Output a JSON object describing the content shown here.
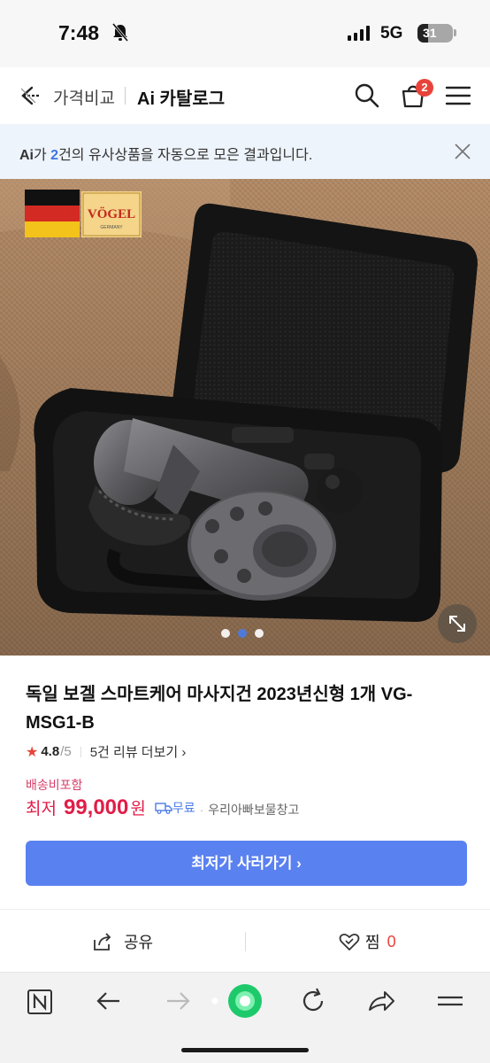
{
  "status_bar": {
    "time": "7:48",
    "network": "5G",
    "battery": "31",
    "battery_level": 0.31
  },
  "header": {
    "compare_label": "가격비교",
    "title": "Ai 카탈로그",
    "cart_count": "2"
  },
  "notice": {
    "prefix": "Ai",
    "mid1": "가 ",
    "count": "2",
    "suffix": "건의 유사상품을 자동으로 모은 결과입니다."
  },
  "product": {
    "brand_text": "VÖGEL",
    "brand_sub": "GERMANY",
    "title": "독일 보겔 스마트케어 마사지건 2023년신형 1개 VG-MSG1-B",
    "rating": "4.8",
    "rating_max": "/5",
    "review_link": "5건 리뷰 더보기",
    "shipping_note": "배송비포함",
    "price_label": "최저",
    "price": "99,000",
    "price_unit": "원",
    "free_shipping": "무료",
    "seller": "우리아빠보물창고",
    "carousel_total": 3,
    "carousel_active": 2
  },
  "actions": {
    "buy_label": "최저가 사러가기",
    "share_label": "공유",
    "like_label": "찜",
    "like_count": "0"
  },
  "colors": {
    "accent": "#5a81f0",
    "price": "#e11d48",
    "badge": "#e8433a"
  }
}
